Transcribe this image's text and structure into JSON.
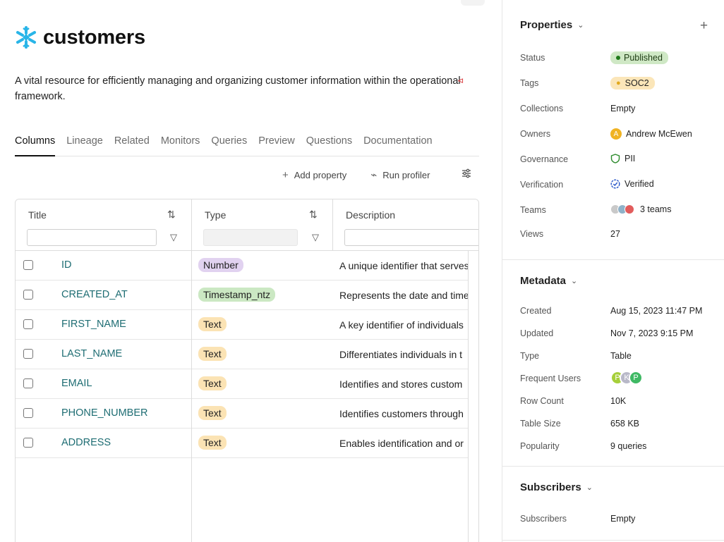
{
  "asset": {
    "title": "customers",
    "description": "A vital resource for efficiently managing and organizing customer information within the operational framework.",
    "logo_icon": "snowflake-icon",
    "brand_color": "#29b5e8"
  },
  "tabs": [
    "Columns",
    "Lineage",
    "Related",
    "Monitors",
    "Queries",
    "Preview",
    "Questions",
    "Documentation"
  ],
  "active_tab": "Columns",
  "toolbar": {
    "add_property": "Add property",
    "run_profiler": "Run profiler"
  },
  "table": {
    "headers": {
      "title": "Title",
      "type": "Type",
      "description": "Description"
    },
    "rows": [
      {
        "name": "ID",
        "type": "Number",
        "type_color": "#e1d2f0",
        "description": "A unique identifier that serves"
      },
      {
        "name": "CREATED_AT",
        "type": "Timestamp_ntz",
        "type_color": "#cbe8c3",
        "description": "Represents the date and time"
      },
      {
        "name": "FIRST_NAME",
        "type": "Text",
        "type_color": "#fbe3b4",
        "description": "A key identifier of individuals"
      },
      {
        "name": "LAST_NAME",
        "type": "Text",
        "type_color": "#fbe3b4",
        "description": "Differentiates individuals in t"
      },
      {
        "name": "EMAIL",
        "type": "Text",
        "type_color": "#fbe3b4",
        "description": "Identifies and stores custom"
      },
      {
        "name": "PHONE_NUMBER",
        "type": "Text",
        "type_color": "#fbe3b4",
        "description": "Identifies customers through"
      },
      {
        "name": "ADDRESS",
        "type": "Text",
        "type_color": "#fbe3b4",
        "description": "Enables identification and or"
      }
    ]
  },
  "properties": {
    "title": "Properties",
    "status_label": "Status",
    "status": "Published",
    "tags_label": "Tags",
    "tag": "SOC2",
    "collections_label": "Collections",
    "collections": "Empty",
    "owners_label": "Owners",
    "owner": "Andrew McEwen",
    "owner_initial": "A",
    "governance_label": "Governance",
    "governance": "PII",
    "verification_label": "Verification",
    "verification": "Verified",
    "teams_label": "Teams",
    "teams": "3 teams",
    "views_label": "Views",
    "views": "27"
  },
  "metadata": {
    "title": "Metadata",
    "created_label": "Created",
    "created": "Aug 15, 2023 11:47 PM",
    "updated_label": "Updated",
    "updated": "Nov 7, 2023 9:15 PM",
    "type_label": "Type",
    "type": "Table",
    "frequent_users_label": "Frequent Users",
    "frequent_users": [
      "P",
      "K",
      "P"
    ],
    "row_count_label": "Row Count",
    "row_count": "10K",
    "table_size_label": "Table Size",
    "table_size": "658 KB",
    "popularity_label": "Popularity",
    "popularity": "9 queries"
  },
  "subscribers": {
    "title": "Subscribers",
    "label": "Subscribers",
    "value": "Empty"
  }
}
